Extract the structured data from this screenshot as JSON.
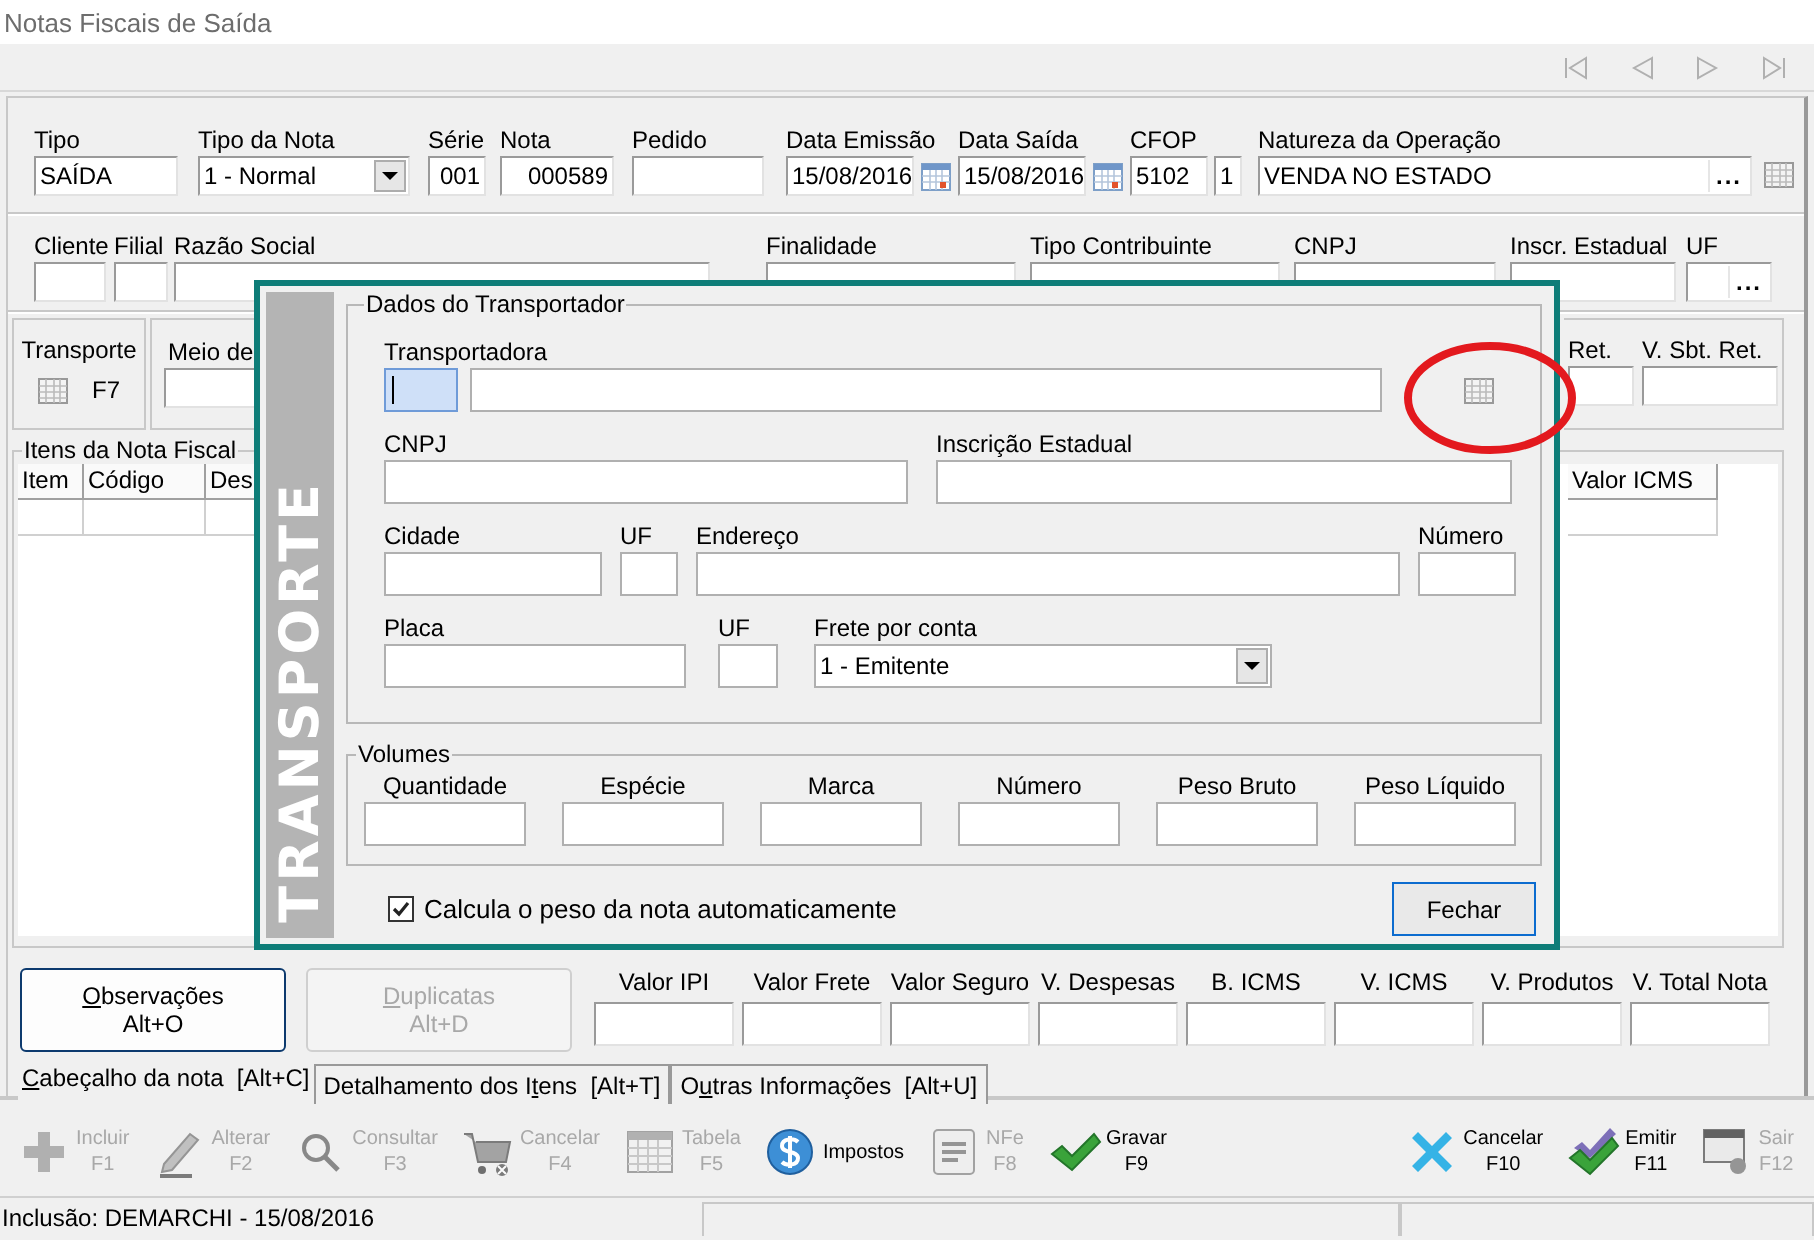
{
  "window": {
    "title": "Notas Fiscais de Saída"
  },
  "record_navigation": [
    {
      "disabled": true
    },
    {
      "disabled": true
    },
    {
      "disabled": true
    },
    {
      "disabled": true
    }
  ],
  "header_row": [
    {
      "label": "Tipo",
      "value": "SAÍDA",
      "kind": "text"
    },
    {
      "label": "Tipo da Nota",
      "value": "1 - Normal",
      "kind": "select"
    },
    {
      "label": "Série",
      "value": "001",
      "kind": "number"
    },
    {
      "label": "Nota",
      "value": "000589",
      "kind": "number"
    },
    {
      "label": "Pedido",
      "kind": "text"
    },
    {
      "label": "Data Emissão",
      "value": "15/08/2016",
      "kind": "date"
    },
    {
      "label": "Data Saída",
      "value": "15/08/2016",
      "kind": "date"
    },
    {
      "label": "CFOP",
      "value": "5102",
      "kind": "text"
    },
    {
      "value": "1",
      "kind": "text"
    },
    {
      "label": "Natureza da Operação",
      "value": "VENDA NO ESTADO",
      "kind": "lookup",
      "button": "..."
    }
  ],
  "client_row": [
    {
      "label": "Cliente",
      "kind": "text"
    },
    {
      "label": "Filial",
      "kind": "text"
    },
    {
      "label": "Razão Social",
      "kind": "text"
    },
    {
      "label": "Finalidade",
      "kind": "select"
    },
    {
      "label": "Tipo Contribuinte",
      "kind": "select"
    },
    {
      "label": "CNPJ",
      "kind": "text"
    },
    {
      "label": "Inscr. Estadual",
      "kind": "text"
    },
    {
      "label": "UF",
      "kind": "lookup",
      "button": "..."
    }
  ],
  "transport_box": {
    "label": "Transporte",
    "key": "F7"
  },
  "payment_box": {
    "label": "Meio de"
  },
  "retention": [
    {
      "label": "Ret."
    },
    {
      "label": "V. Sbt. Ret."
    }
  ],
  "items": {
    "title": "Itens da Nota Fiscal",
    "columns": [
      "Item",
      "Código",
      "Des"
    ],
    "right_column": "Valor ICMS"
  },
  "actions": [
    {
      "hotkey": "O",
      "after": "bservações",
      "shortcut": "Alt+O",
      "disabled": false
    },
    {
      "hotkey": "D",
      "after": "uplicatas",
      "shortcut": "Alt+D",
      "disabled": true
    }
  ],
  "totals": [
    "Valor IPI",
    "Valor Frete",
    "Valor Seguro",
    "V. Despesas",
    "B. ICMS",
    "V. ICMS",
    "V. Produtos",
    "V. Total Nota"
  ],
  "tabs": [
    {
      "hotkey": "C",
      "after": "abeçalho da nota  [Alt+C]",
      "selected": true
    },
    {
      "before": "Detalhamento dos I",
      "hotkey": "t",
      "after": "ens  [Alt+T]",
      "selected": false
    },
    {
      "before": "O",
      "hotkey": "u",
      "after": "tras Informações  [Alt+U]",
      "selected": false
    }
  ],
  "toolbar_left": [
    {
      "label": "Incluir",
      "key": "F1",
      "disabled": true
    },
    {
      "label": "Alterar",
      "key": "F2",
      "disabled": true
    },
    {
      "label": "Consultar",
      "key": "F3",
      "disabled": true
    },
    {
      "label": "Cancelar",
      "key": "F4",
      "disabled": true
    },
    {
      "label": "Tabela",
      "key": "F5",
      "disabled": true
    },
    {
      "label": "Impostos",
      "disabled": false
    },
    {
      "label": "NFe",
      "key": "F8",
      "disabled": true
    },
    {
      "label": "Gravar",
      "key": "F9",
      "disabled": false
    }
  ],
  "toolbar_right": [
    {
      "label": "Cancelar",
      "key": "F10",
      "disabled": false
    },
    {
      "label": "Emitir",
      "key": "F11",
      "disabled": false
    },
    {
      "label": "Sair",
      "key": "F12",
      "disabled": true
    }
  ],
  "status_bar": {
    "text": "Inclusão: DEMARCHI - 15/08/2016"
  },
  "dialog": {
    "side_title": "TRANSPORTE",
    "carrier_group": {
      "title": "Dados do Transportador",
      "carrier_label": "Transportadora",
      "fields": [
        {
          "label": "CNPJ"
        },
        {
          "label": "Inscrição Estadual"
        },
        {
          "label": "Cidade"
        },
        {
          "label": "UF"
        },
        {
          "label": "Endereço"
        },
        {
          "label": "Número"
        },
        {
          "label": "Placa"
        },
        {
          "label": "UF"
        }
      ],
      "freight": {
        "label": "Frete por conta",
        "value": "1 - Emitente"
      }
    },
    "volumes": {
      "title": "Volumes",
      "columns": [
        "Quantidade",
        "Espécie",
        "Marca",
        "Número",
        "Peso Bruto",
        "Peso Líquido"
      ]
    },
    "auto_weight": {
      "label": "Calcula o peso da nota automaticamente",
      "checked": true
    },
    "close_button": "Fechar"
  },
  "highlight": {
    "shown": true
  }
}
